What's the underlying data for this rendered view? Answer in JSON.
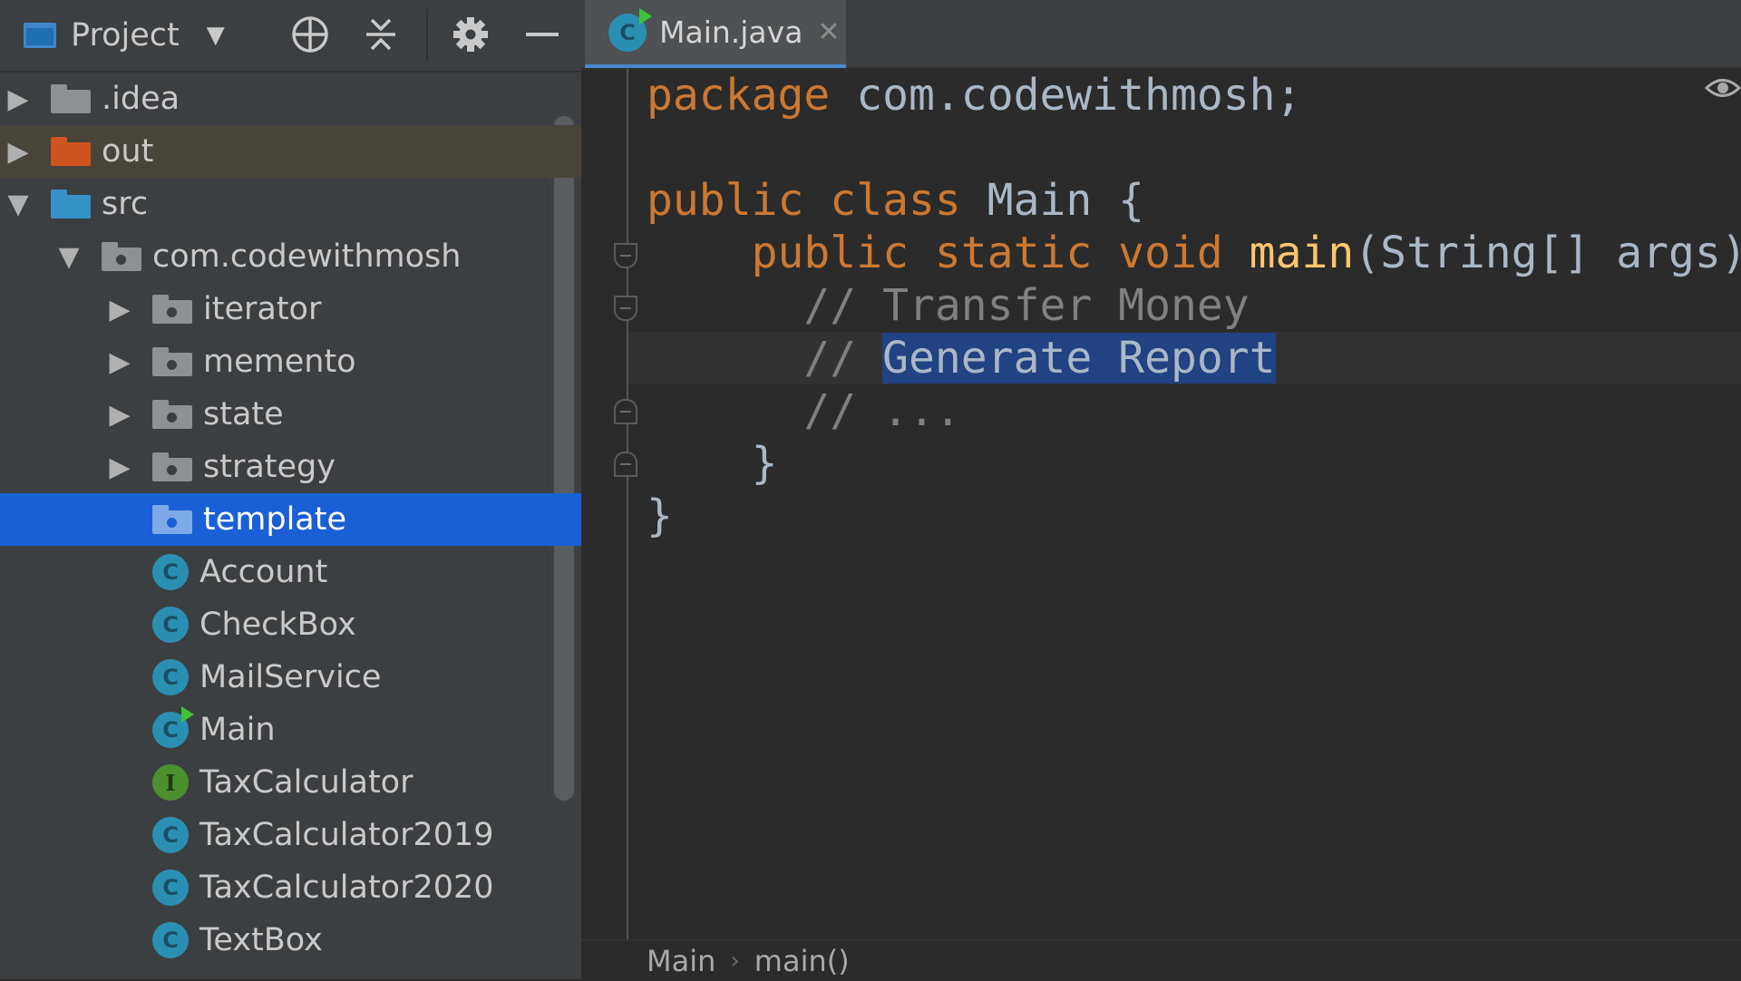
{
  "project_panel": {
    "title": "Project",
    "tree": [
      {
        "label": ".idea",
        "level": 0,
        "expanded": false,
        "kind": "folder",
        "color": "#8c9194"
      },
      {
        "label": "out",
        "level": 0,
        "expanded": false,
        "kind": "folder",
        "color": "#d0541f"
      },
      {
        "label": "src",
        "level": 0,
        "expanded": true,
        "kind": "folder",
        "color": "#3592c4"
      },
      {
        "label": "com.codewithmosh",
        "level": 1,
        "expanded": true,
        "kind": "package"
      },
      {
        "label": "iterator",
        "level": 2,
        "expanded": false,
        "kind": "package"
      },
      {
        "label": "memento",
        "level": 2,
        "expanded": false,
        "kind": "package"
      },
      {
        "label": "state",
        "level": 2,
        "expanded": false,
        "kind": "package"
      },
      {
        "label": "strategy",
        "level": 2,
        "expanded": false,
        "kind": "package"
      },
      {
        "label": "template",
        "level": 2,
        "kind": "package",
        "selected": true
      },
      {
        "label": "Account",
        "level": 2,
        "kind": "class",
        "icon_letter": "C"
      },
      {
        "label": "CheckBox",
        "level": 2,
        "kind": "class",
        "icon_letter": "C"
      },
      {
        "label": "MailService",
        "level": 2,
        "kind": "class",
        "icon_letter": "C"
      },
      {
        "label": "Main",
        "level": 2,
        "kind": "class",
        "icon_letter": "C",
        "runnable": true
      },
      {
        "label": "TaxCalculator",
        "level": 2,
        "kind": "interface",
        "icon_letter": "I"
      },
      {
        "label": "TaxCalculator2019",
        "level": 2,
        "kind": "class",
        "icon_letter": "C"
      },
      {
        "label": "TaxCalculator2020",
        "level": 2,
        "kind": "class",
        "icon_letter": "C"
      },
      {
        "label": "TextBox",
        "level": 2,
        "kind": "class",
        "icon_letter": "C"
      }
    ]
  },
  "editor": {
    "tab": {
      "label": "Main.java",
      "icon_letter": "C",
      "close": "✕"
    },
    "code": {
      "l1_kw": "package",
      "l1_rest": " com.codewithmosh;",
      "l3_kw": "public class",
      "l3_rest": " Main {",
      "l4_kw": "    public static void",
      "l4_fn": " main",
      "l4_rest": "(String[] args) {",
      "l5_cm": "      // Transfer Money",
      "l6_prefix": "      // ",
      "l6_sel": "Generate Report",
      "l7_cm": "      // ...",
      "l8": "    }",
      "l9": "}"
    },
    "breadcrumb": {
      "item1": "Main",
      "separator": "›",
      "item2": "main()"
    }
  },
  "colors": {
    "keyword": "#cc7832",
    "function": "#ffc66d",
    "comment": "#808080",
    "selection": "#214283",
    "tree_selected": "#1a5fd6"
  }
}
